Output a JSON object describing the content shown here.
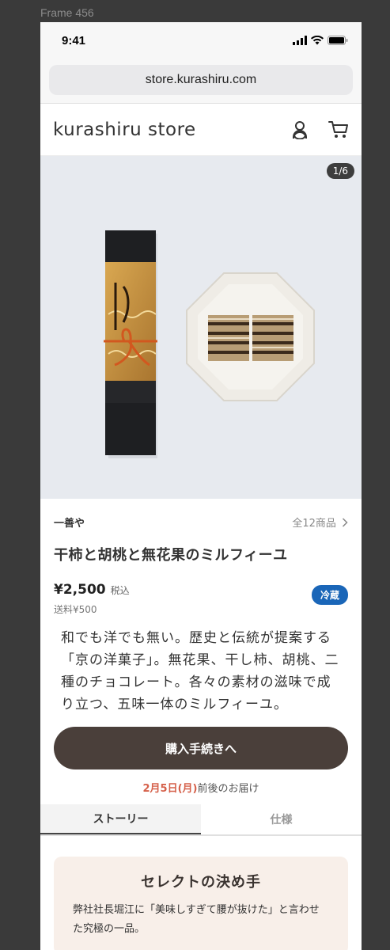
{
  "frame_label": "Frame 456",
  "status_bar": {
    "time": "9:41"
  },
  "browser": {
    "url": "store.kurashiru.com"
  },
  "site": {
    "logo": "kurashiru store",
    "icons": [
      "user-icon",
      "cart-icon"
    ]
  },
  "gallery": {
    "counter": "1/6"
  },
  "product": {
    "brand": "一善や",
    "all_items": "全12商品",
    "title": "干柿と胡桃と無花果のミルフィーユ",
    "price": "¥2,500",
    "tax_label": "税込",
    "shipping": "送料¥500",
    "badge": "冷蔵",
    "description": "和でも洋でも無い。歴史と伝統が提案する「京の洋菓子」。無花果、干し柿、胡桃、二種のチョコレート。各々の素材の滋味で成り立つ、五味一体のミルフィーユ。",
    "buy_label": "購入手続きへ",
    "delivery_date": "2月5日(月)",
    "delivery_suffix": "前後のお届け"
  },
  "tabs": [
    {
      "label": "ストーリー",
      "active": true
    },
    {
      "label": "仕様",
      "active": false
    }
  ],
  "story": {
    "title": "セレクトの決め手",
    "text": "弊社社長堀江に「美味しすぎて腰が抜けた」と言わせた究極の一品。"
  },
  "colors": {
    "buy_button": "#4a3f3a",
    "badge": "#1a66b8",
    "delivery_date": "#d5604a",
    "story_bg": "#f8efe9"
  }
}
